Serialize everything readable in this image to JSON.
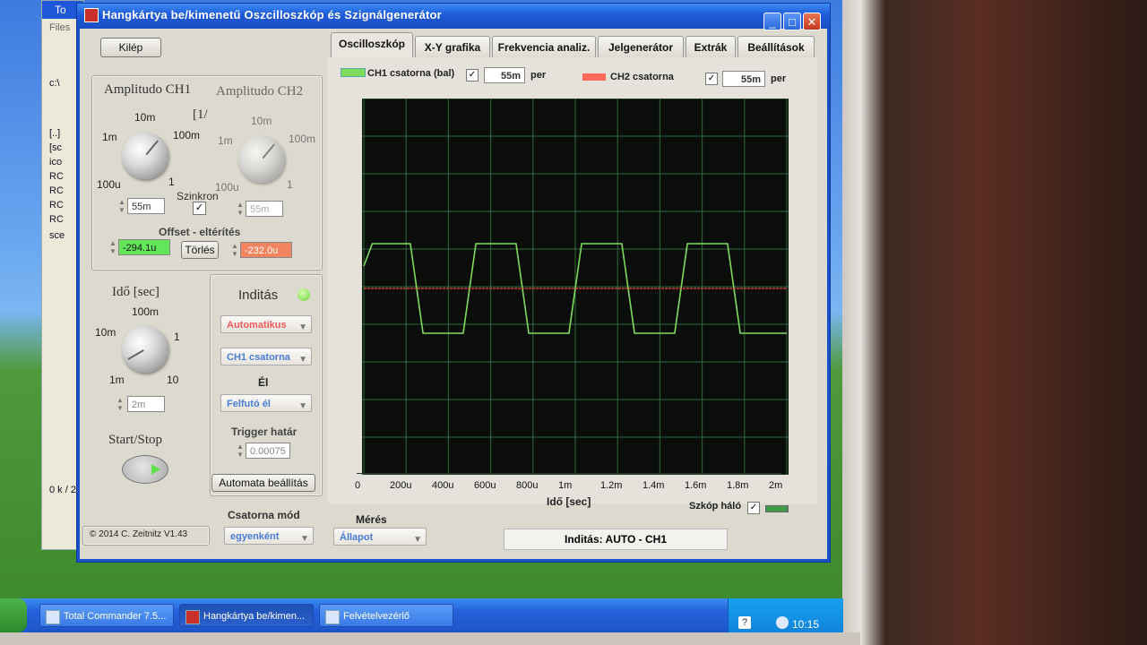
{
  "taskbar": {
    "items": [
      {
        "label": "Total Commander 7.5..."
      },
      {
        "label": "Hangkártya be/kimen..."
      },
      {
        "label": "Felvételvezérlő"
      }
    ],
    "clock": "10:15"
  },
  "bg_window": {
    "title": "To",
    "menu": "Files",
    "path": "c:\\",
    "rows": [
      "[..]",
      "[sc",
      "ico",
      "RC",
      "RC",
      "RC",
      "RC",
      "sce"
    ],
    "status": "0 k / 2"
  },
  "window": {
    "title": "Hangkártya be/kimenetű Oszcilloszkóp és Szignálgenerátor",
    "min": "_",
    "max": "□",
    "close": "✕"
  },
  "left": {
    "exit_button": "Kilép",
    "amp_ch1": "Amplitudo CH1",
    "amp_ch2": "Amplitudo CH2",
    "bracket": "[1/",
    "ch1_ticks": {
      "t10m": "10m",
      "t1m": "1m",
      "t100m": "100m",
      "t100u": "100u",
      "t1": "1"
    },
    "ch2_ticks": {
      "t10m": "10m",
      "t1m": "1m",
      "t100m": "100m",
      "t100u": "100u",
      "t1": "1"
    },
    "ch1_value": "55m",
    "ch2_value": "55m",
    "sync_label": "Szinkron",
    "offset_label": "Offset - eltérítés",
    "offset_ch1": "-294.1u",
    "offset_ch2": "-232.0u",
    "clear_button": "Törlés",
    "time_label": "Idő [sec]",
    "time_ticks": {
      "t100m": "100m",
      "t10m": "10m",
      "t1": "1",
      "t1m": "1m",
      "t10": "10"
    },
    "time_value": "2m",
    "startstop_label": "Start/Stop",
    "copyright": "© 2014   C. Zeitnitz V1.43"
  },
  "trigger": {
    "title": "Inditás",
    "mode": "Automatikus",
    "channel": "CH1 csatorna",
    "edge_label": "Él",
    "edge": "Felfutó él",
    "threshold_label": "Trigger határ",
    "threshold": "0.00075",
    "auto_button": "Automata beállítás",
    "channel_mode_label": "Csatorna mód",
    "channel_mode": "egyenként"
  },
  "tabs": [
    {
      "label": "Oscilloszkóp"
    },
    {
      "label": "X-Y grafika"
    },
    {
      "label": "Frekvencia analiz."
    },
    {
      "label": "Jelgenerátor"
    },
    {
      "label": "Extrák"
    },
    {
      "label": "Beállítások"
    }
  ],
  "scope_header": {
    "ch1_label": "CH1 csatorna (bal)",
    "ch1_scale": "55m",
    "ch1_unit": "per",
    "ch2_label": "CH2 csatorna",
    "ch2_scale": "55m",
    "ch2_unit": "per"
  },
  "scope": {
    "xlabel": "Idő [sec]",
    "ticks": [
      "0",
      "200u",
      "400u",
      "600u",
      "800u",
      "1m",
      "1.2m",
      "1.4m",
      "1.6m",
      "1.8m",
      "2m"
    ],
    "grid_label": "Szkóp háló",
    "colors": {
      "ch1": "#7edc5a",
      "ch2": "#ff4b3a",
      "bg": "#0b0d0b",
      "grid": "#2f6a3c"
    }
  },
  "bottom": {
    "measure_label": "Mérés",
    "measure_value": "Állapot",
    "status": "Inditás: AUTO - CH1"
  },
  "chart_data": {
    "type": "line",
    "xlabel": "Idő [sec]",
    "xlim": [
      0,
      0.002
    ],
    "x_ticks": [
      "0",
      "200u",
      "400u",
      "600u",
      "800u",
      "1m",
      "1.2m",
      "1.4m",
      "1.6m",
      "1.8m",
      "2m"
    ],
    "series": [
      {
        "name": "CH1 csatorna (bal)",
        "color": "#7edc5a",
        "x": [
          0,
          4e-05,
          0.00022,
          0.00028,
          0.00047,
          0.00053,
          0.00072,
          0.00078,
          0.00097,
          0.00103,
          0.00122,
          0.00128,
          0.00147,
          0.00153,
          0.00172,
          0.00178,
          0.00197,
          0.002
        ],
        "y": [
          0.5,
          1.0,
          1.0,
          -1.0,
          -1.0,
          1.0,
          1.0,
          -1.0,
          -1.0,
          1.0,
          1.0,
          -1.0,
          -1.0,
          1.0,
          1.0,
          -1.0,
          -1.0,
          -1.0
        ]
      },
      {
        "name": "CH2 csatorna",
        "color": "#ff4b3a",
        "x": [
          0,
          0.002
        ],
        "y": [
          0,
          0
        ]
      }
    ]
  }
}
